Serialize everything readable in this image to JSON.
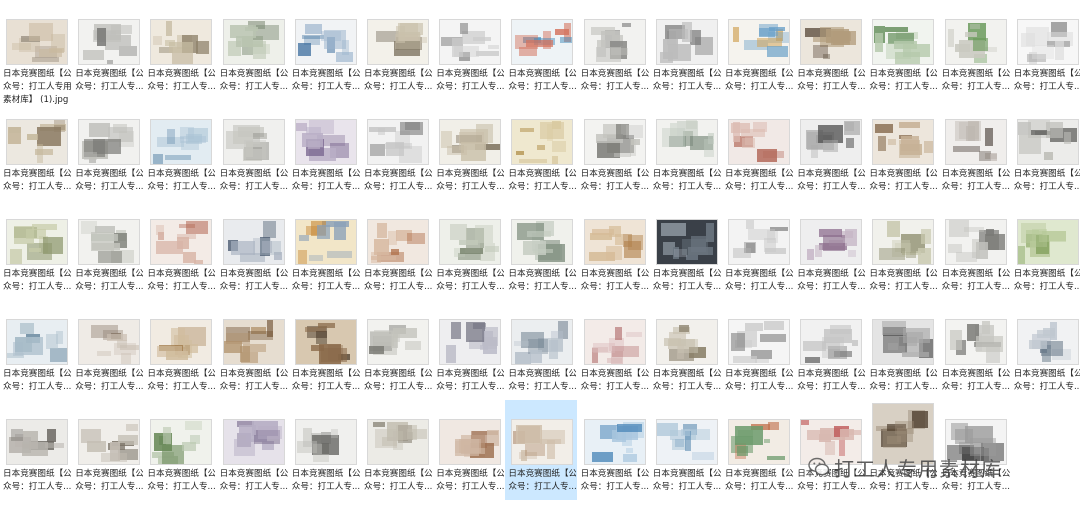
{
  "files": [
    {
      "line1": "日本竞赛图纸【公",
      "line2": "众号：打工人专用",
      "line3": "素材库】 (1).jpg",
      "c": [
        "#e8e0d4",
        "#9a8f80",
        "#c9b9a0"
      ]
    },
    {
      "line1": "日本竞赛图纸【公",
      "line2": "众号：打工人专...",
      "c": [
        "#f2f2f0",
        "#7a7a78",
        "#bfbfbb"
      ]
    },
    {
      "line1": "日本竞赛图纸【公",
      "line2": "众号：打工人专...",
      "c": [
        "#efe9de",
        "#8c8068",
        "#c8bda4"
      ]
    },
    {
      "line1": "日本竞赛图纸【公",
      "line2": "众号：打工人专...",
      "c": [
        "#eef0ea",
        "#7b8a73",
        "#b9c4b0"
      ]
    },
    {
      "line1": "日本竞赛图纸【公",
      "line2": "众号：打工人专...",
      "c": [
        "#f1f3f5",
        "#3c6d9e",
        "#9bb4cc"
      ]
    },
    {
      "line1": "日本竞赛图纸【公",
      "line2": "众号：打工人专...",
      "c": [
        "#f3f1ea",
        "#7c7361",
        "#c9c1ac"
      ]
    },
    {
      "line1": "日本竞赛图纸【公",
      "line2": "众号：打工人专...",
      "c": [
        "#f4f4f4",
        "#888888",
        "#cccccc"
      ]
    },
    {
      "line1": "日本竞赛图纸【公",
      "line2": "众号：打工人专...",
      "c": [
        "#eef3f6",
        "#3a86b8",
        "#d4735e"
      ]
    },
    {
      "line1": "日本竞赛图纸【公",
      "line2": "众号：打工人专...",
      "c": [
        "#f2f2f0",
        "#8a8a88",
        "#c3c3bf"
      ]
    },
    {
      "line1": "日本竞赛图纸【公",
      "line2": "众号：打工人专...",
      "c": [
        "#f0f0f0",
        "#777777",
        "#bbbbbb"
      ]
    },
    {
      "line1": "日本竞赛图纸【公",
      "line2": "众号：打工人专...",
      "c": [
        "#f5f3ee",
        "#d1a45a",
        "#6aa0c8"
      ]
    },
    {
      "line1": "日本竞赛图纸【公",
      "line2": "众号：打工人专...",
      "c": [
        "#ece6dc",
        "#5a4a3a",
        "#b29c7c"
      ]
    },
    {
      "line1": "日本竞赛图纸【公",
      "line2": "众号：打工人专...",
      "c": [
        "#f1f4ef",
        "#5f8a55",
        "#b5c9ab"
      ]
    },
    {
      "line1": "日本竞赛图纸【公",
      "line2": "众号：打工人专...",
      "c": [
        "#f2f2ef",
        "#6a9a5a",
        "#c9c9c0"
      ]
    },
    {
      "line1": "日本竞赛图纸【公",
      "line2": "众号：打工人专...",
      "c": [
        "#f7f7f7",
        "#999999",
        "#dddddd"
      ]
    },
    {
      "line1": "日本竞赛图纸【公",
      "line2": "众号：打工人专...",
      "c": [
        "#ece8e0",
        "#8a7a62",
        "#c4b69a"
      ]
    },
    {
      "line1": "日本竞赛图纸【公",
      "line2": "众号：打工人专...",
      "c": [
        "#f1f1ef",
        "#7b7b77",
        "#c0c0bb"
      ]
    },
    {
      "line1": "日本竞赛图纸【公",
      "line2": "众号：打工人专...",
      "c": [
        "#e2ecf2",
        "#5b86a8",
        "#a9c2d4"
      ]
    },
    {
      "line1": "日本竞赛图纸【公",
      "line2": "众号：打工人专...",
      "c": [
        "#f0f0ee",
        "#85857f",
        "#c6c6c0"
      ]
    },
    {
      "line1": "日本竞赛图纸【公",
      "line2": "众号：打工人专...",
      "c": [
        "#e9e4ec",
        "#7a6690",
        "#b9aec6"
      ]
    },
    {
      "line1": "日本竞赛图纸【公",
      "line2": "众号：打工人专...",
      "c": [
        "#f2f2f2",
        "#808080",
        "#c4c4c4"
      ]
    },
    {
      "line1": "日本竞赛图纸【公",
      "line2": "众号：打工人专...",
      "c": [
        "#f1efe8",
        "#807560",
        "#c8bea8"
      ]
    },
    {
      "line1": "日本竞赛图纸【公",
      "line2": "众号：打工人专...",
      "c": [
        "#efe8cf",
        "#b89a5a",
        "#d8c9a0"
      ]
    },
    {
      "line1": "日本竞赛图纸【公",
      "line2": "众号：打工人专...",
      "c": [
        "#f3f3f1",
        "#7c7c78",
        "#c3c3be"
      ]
    },
    {
      "line1": "日本竞赛图纸【公",
      "line2": "众号：打工人专...",
      "c": [
        "#f2f2ef",
        "#7a8a7c",
        "#c0cabf"
      ]
    },
    {
      "line1": "日本竞赛图纸【公",
      "line2": "众号：打工人专...",
      "c": [
        "#f1e9e6",
        "#b46a5a",
        "#dcbcb2"
      ]
    },
    {
      "line1": "日本竞赛图纸【公",
      "line2": "众号：打工人专...",
      "c": [
        "#eeeeee",
        "#555555",
        "#aaaaaa"
      ]
    },
    {
      "line1": "日本竞赛图纸【公",
      "line2": "众号：打工人专...",
      "c": [
        "#ede6dc",
        "#8a6f52",
        "#c7b296"
      ]
    },
    {
      "line1": "日本竞赛图纸【公",
      "line2": "众号：打工人专...",
      "c": [
        "#f0eeec",
        "#6f6660",
        "#bdb6b0"
      ]
    },
    {
      "line1": "日本竞赛图纸【公",
      "line2": "众号：打工人专...",
      "c": [
        "#ececea",
        "#6f6f6b",
        "#bbbbb6"
      ]
    },
    {
      "line1": "日本竞赛图纸【公",
      "line2": "众号：打工人专...",
      "c": [
        "#eef0e6",
        "#8a946a",
        "#c6cba8"
      ]
    },
    {
      "line1": "日本竞赛图纸【公",
      "line2": "众号：打工人专...",
      "c": [
        "#f2f2ef",
        "#7b7d75",
        "#c2c4bc"
      ]
    },
    {
      "line1": "日本竞赛图纸【公",
      "line2": "众号：打工人专...",
      "c": [
        "#f3ebe6",
        "#b0604a",
        "#d8b4a6"
      ]
    },
    {
      "line1": "日本竞赛图纸【公",
      "line2": "众号：打工人专...",
      "c": [
        "#e9ebee",
        "#4a5a70",
        "#a8b2c0"
      ]
    },
    {
      "line1": "日本竞赛图纸【公",
      "line2": "众号：打工人专...",
      "c": [
        "#f2e6c8",
        "#c88a3a",
        "#8aa0b8"
      ]
    },
    {
      "line1": "日本竞赛图纸【公",
      "line2": "众号：打工人专...",
      "c": [
        "#f1e8e0",
        "#b0704a",
        "#d6b8a0"
      ]
    },
    {
      "line1": "日本竞赛图纸【公",
      "line2": "众号：打工人专...",
      "c": [
        "#eef0ea",
        "#7a8670",
        "#c2c9ba"
      ]
    },
    {
      "line1": "日本竞赛图纸【公",
      "line2": "众号：打工人专...",
      "c": [
        "#f0f1ec",
        "#7a8a7a",
        "#c5cdc2"
      ]
    },
    {
      "line1": "日本竞赛图纸【公",
      "line2": "众号：打工人专...",
      "c": [
        "#efe4d6",
        "#b0804a",
        "#d6bc98"
      ]
    },
    {
      "line1": "日本竞赛图纸【公",
      "line2": "众号：打工人专...",
      "c": [
        "#3a4048",
        "#9aa4ae",
        "#6b7580"
      ]
    },
    {
      "line1": "日本竞赛图纸【公",
      "line2": "众号：打工人专...",
      "c": [
        "#f3f3f3",
        "#8a8a8a",
        "#c8c8c8"
      ]
    },
    {
      "line1": "日本竞赛图纸【公",
      "line2": "众号：打工人专...",
      "c": [
        "#eeeeef",
        "#8a6a8a",
        "#c5b5c5"
      ]
    },
    {
      "line1": "日本竞赛图纸【公",
      "line2": "众号：打工人专...",
      "c": [
        "#f1f1ec",
        "#8a8a6a",
        "#c9c9b0"
      ]
    },
    {
      "line1": "日本竞赛图纸【公",
      "line2": "众号：打工人专...",
      "c": [
        "#f2f2f0",
        "#7a7a76",
        "#c2c2bd"
      ]
    },
    {
      "line1": "日本竞赛图纸【公",
      "line2": "众号：打工人专...",
      "c": [
        "#dfe8cf",
        "#7a9a52",
        "#b8c99a"
      ]
    },
    {
      "line1": "日本竞赛图纸【公",
      "line2": "众号：打工人专...",
      "c": [
        "#e8eef2",
        "#6a8aa0",
        "#b0c2ce"
      ]
    },
    {
      "line1": "日本竞赛图纸【公",
      "line2": "众号：打工人专...",
      "c": [
        "#efebe6",
        "#8a7a6a",
        "#c9beb2"
      ]
    },
    {
      "line1": "日本竞赛图纸【公",
      "line2": "众号：打工人专...",
      "c": [
        "#f1ebe2",
        "#a07a4a",
        "#d0bc9c"
      ]
    },
    {
      "line1": "日本竞赛图纸【公",
      "line2": "众号：打工人专...",
      "c": [
        "#e6ddd0",
        "#6a4a2a",
        "#b0906a"
      ]
    },
    {
      "line1": "日本竞赛图纸【公",
      "line2": "众号：打工人专...",
      "c": [
        "#d8c8b0",
        "#3a2a1a",
        "#8a6a4a"
      ]
    },
    {
      "line1": "日本竞赛图纸【公",
      "line2": "众号：打工人专...",
      "c": [
        "#f2f2ef",
        "#7a7a74",
        "#c3c3bc"
      ]
    },
    {
      "line1": "日本竞赛图纸【公",
      "line2": "众号：打工人专...",
      "c": [
        "#eeeef0",
        "#6a6a7a",
        "#bcbcc8"
      ]
    },
    {
      "line1": "日本竞赛图纸【公",
      "line2": "众号：打工人专...",
      "c": [
        "#ebeef0",
        "#6a7a8a",
        "#b6c0ca"
      ]
    },
    {
      "line1": "日本竞赛图纸【公",
      "line2": "众号：打工人专...",
      "c": [
        "#f3ebe8",
        "#b06a6a",
        "#d8b8b8"
      ]
    },
    {
      "line1": "日本竞赛图纸【公",
      "line2": "众号：打工人专...",
      "c": [
        "#f2f0ec",
        "#8a806a",
        "#c9c2b2"
      ]
    },
    {
      "line1": "日本竞赛图纸【公",
      "line2": "众号：打工人专...",
      "c": [
        "#f5f5f5",
        "#808080",
        "#cccccc"
      ]
    },
    {
      "line1": "日本竞赛图纸【公",
      "line2": "众号：打工人专...",
      "c": [
        "#f1f1f1",
        "#7a7a7a",
        "#c4c4c4"
      ]
    },
    {
      "line1": "日本竞赛图纸【公",
      "line2": "众号：打工人专...",
      "c": [
        "#e4e4e4",
        "#5a5a5a",
        "#a8a8a8"
      ]
    },
    {
      "line1": "日本竞赛图纸【公",
      "line2": "众号：打工人专...",
      "c": [
        "#f3f3f1",
        "#7c7c78",
        "#c6c6c1"
      ]
    },
    {
      "line1": "日本竞赛图纸【公",
      "line2": "众号：打工人专...",
      "c": [
        "#f1f2f3",
        "#6a7a8a",
        "#c0c8d0"
      ]
    },
    {
      "line1": "日本竞赛图纸【公",
      "line2": "众号：打工人专...",
      "c": [
        "#ecebe8",
        "#6a6660",
        "#b8b4ae"
      ]
    },
    {
      "line1": "日本竞赛图纸【公",
      "line2": "众号：打工人专...",
      "c": [
        "#f0eeea",
        "#7a7266",
        "#c4beb4"
      ]
    },
    {
      "line1": "日本竞赛图纸【公",
      "line2": "众号：打工人专...",
      "c": [
        "#f0f2ec",
        "#6a8a5a",
        "#bccab2"
      ]
    },
    {
      "line1": "日本竞赛图纸【公",
      "line2": "众号：打工人专...",
      "c": [
        "#e6e2ea",
        "#6a5a80",
        "#b6aec4"
      ]
    },
    {
      "line1": "日本竞赛图纸【公",
      "line2": "众号：打工人专...",
      "c": [
        "#f0f0ee",
        "#6a6a66",
        "#bdbdb8"
      ]
    },
    {
      "line1": "日本竞赛图纸【公",
      "line2": "众号：打工人专...",
      "c": [
        "#ecebe6",
        "#7a7466",
        "#c2bdb0"
      ]
    },
    {
      "line1": "日本竞赛图纸【公",
      "line2": "众号：打工人专...",
      "c": [
        "#f0e8e2",
        "#9a6a4a",
        "#cfb6a2"
      ]
    },
    {
      "line1": "日本竞赛图纸【公",
      "line2": "众号：打工人专...",
      "c": [
        "#f2eee8",
        "#a07a5a",
        "#d0c0ac"
      ]
    },
    {
      "line1": "日本竞赛图纸【公",
      "line2": "众号：打工人专...",
      "c": [
        "#e8f0f6",
        "#4a86b8",
        "#a8c6de"
      ]
    },
    {
      "line1": "日本竞赛图纸【公",
      "line2": "众号：打工人专...",
      "c": [
        "#eef2f6",
        "#5a8ab0",
        "#b0c8da"
      ]
    },
    {
      "line1": "日本竞赛图纸【公",
      "line2": "众号：打工人专...",
      "c": [
        "#f2ece4",
        "#c0704a",
        "#6a9a6a"
      ]
    },
    {
      "line1": "日本竞赛图纸【公",
      "line2": "众号：打工人专...",
      "c": [
        "#f3ece8",
        "#c05a5a",
        "#d8b8b0"
      ]
    },
    {
      "line1": "日本竞赛图纸【公",
      "line2": "众号：打工人专...",
      "c": [
        "#d8d0c4",
        "#4a3a2a",
        "#9a8a76"
      ]
    },
    {
      "line1": "日本竞赛图纸【公",
      "line2": "众号：打工人专...",
      "c": [
        "#f4f4f4",
        "#333333",
        "#9a9a9a"
      ]
    }
  ],
  "watermark": {
    "text": "打工人专用素材库"
  }
}
